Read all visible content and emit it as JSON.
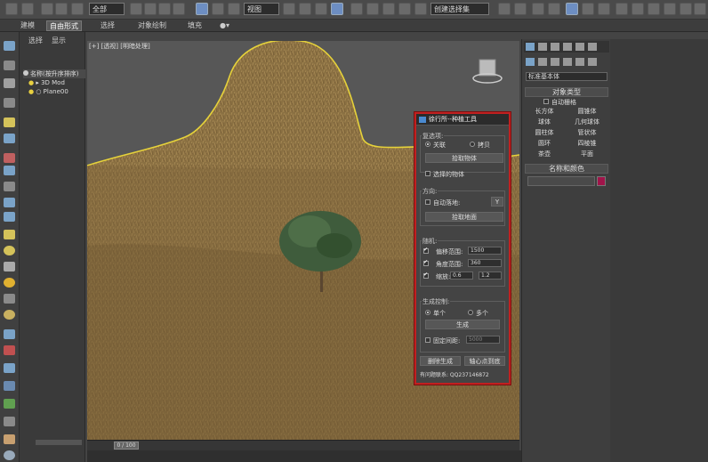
{
  "toolbar": {
    "selection_filter": "全部",
    "ref_coord": "视图",
    "named_sel": "创建选择集"
  },
  "ribbon": {
    "tabs": [
      "建模",
      "自由形式",
      "选择",
      "对象绘制",
      "填充"
    ]
  },
  "scene_explorer": {
    "tabs": [
      "选择",
      "显示"
    ],
    "header": "名称(按升序排序)",
    "items": [
      "3D Mod",
      "Plane00"
    ]
  },
  "viewport": {
    "label": "[+] [透视] [明暗处理]"
  },
  "timeline": {
    "frame": "0 / 100"
  },
  "command_panel": {
    "dropdown": "标准基本体",
    "object_type_title": "对象类型",
    "auto_grid": "自动栅格",
    "buttons": [
      "长方体",
      "圆锥体",
      "球体",
      "几何球体",
      "圆柱体",
      "管状体",
      "圆环",
      "四棱锥",
      "茶壶",
      "平面"
    ],
    "name_color_title": "名称和颜色",
    "color_swatch": "#a0144a"
  },
  "dialog": {
    "title": "徐行所--种植工具",
    "group1": {
      "label": "复选项:",
      "radio1": "关联",
      "radio2": "拷贝",
      "pick_button": "拾取物体",
      "selected_objects": "选择的物体"
    },
    "group2": {
      "label": "方向:",
      "auto_ground": "自动落地:",
      "axis": "Y",
      "pick_ground": "拾取地面"
    },
    "group3": {
      "label": "随机:",
      "offset_label": "偏移范围:",
      "offset_value": "1500",
      "angle_label": "角度范围:",
      "angle_value": "360",
      "scale_label": "缩放:",
      "scale_min": "0.6",
      "scale_max": "1.2"
    },
    "group4": {
      "label": "生成控制:",
      "radio1": "单个",
      "radio2": "多个",
      "generate": "生成",
      "fixed_spacing": "固定间距:",
      "spacing_value": "5000"
    },
    "delete_button": "删除生成",
    "pivot_button": "轴心点到底",
    "footer": "有问题联系: QQ237146872"
  }
}
